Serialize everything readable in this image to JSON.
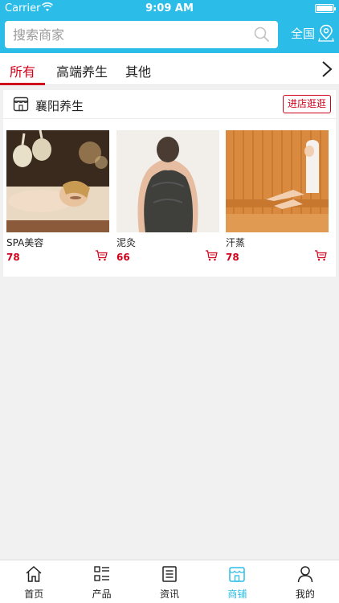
{
  "status_bar": {
    "carrier": "Carrier",
    "time": "9:09 AM"
  },
  "search": {
    "placeholder": "搜索商家",
    "region_label": "全国"
  },
  "tabs": [
    {
      "label": "所有",
      "active": true
    },
    {
      "label": "高端养生",
      "active": false
    },
    {
      "label": "其他",
      "active": false
    }
  ],
  "shop": {
    "name": "襄阳养生",
    "enter_label": "进店逛逛",
    "products": [
      {
        "name": "SPA美容",
        "price": "78"
      },
      {
        "name": "泥灸",
        "price": "66"
      },
      {
        "name": "汗蒸",
        "price": "78"
      }
    ]
  },
  "bottom_nav": [
    {
      "label": "首页",
      "icon": "home-icon",
      "active": false
    },
    {
      "label": "产品",
      "icon": "list-icon",
      "active": false
    },
    {
      "label": "资讯",
      "icon": "news-icon",
      "active": false
    },
    {
      "label": "商铺",
      "icon": "store-icon",
      "active": true
    },
    {
      "label": "我的",
      "icon": "user-icon",
      "active": false
    }
  ],
  "colors": {
    "brand": "#2bbde8",
    "accent_red": "#d0021b"
  }
}
